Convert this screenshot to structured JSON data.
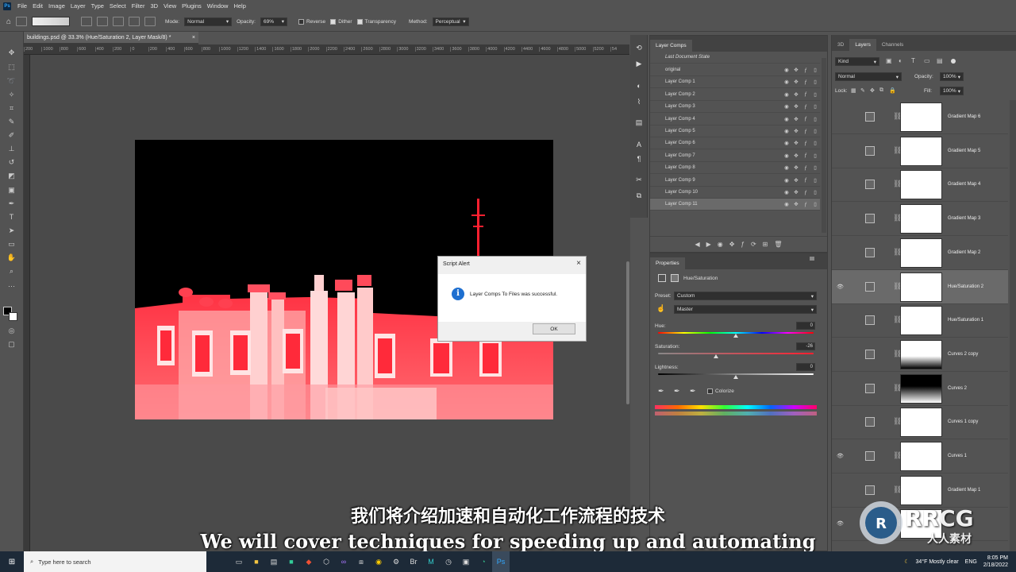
{
  "menu": [
    "File",
    "Edit",
    "Image",
    "Layer",
    "Type",
    "Select",
    "Filter",
    "3D",
    "View",
    "Plugins",
    "Window",
    "Help"
  ],
  "options": {
    "mode_label": "Mode:",
    "mode_value": "Normal",
    "opacity_label": "Opacity:",
    "opacity_value": "69%",
    "reverse_label": "Reverse",
    "dither_label": "Dither",
    "transparency_label": "Transparency",
    "method_label": "Method:",
    "method_value": "Perceptual"
  },
  "document_tab": "buildings.psd @ 33.3% (Hue/Saturation 2, Layer Mask/8) *",
  "ruler_ticks": [
    "200",
    "1000",
    "800",
    "600",
    "400",
    "200",
    "0",
    "200",
    "400",
    "600",
    "800",
    "1000",
    "1200",
    "1400",
    "1600",
    "1800",
    "2000",
    "2200",
    "2400",
    "2600",
    "2800",
    "3000",
    "3200",
    "3400",
    "3600",
    "3800",
    "4000",
    "4200",
    "4400",
    "4600",
    "4800",
    "5000",
    "5200",
    "54"
  ],
  "dialog": {
    "title": "Script Alert",
    "message": "Layer Comps To Files was successful.",
    "ok_label": "OK"
  },
  "layer_comps": {
    "tab_label": "Layer Comps",
    "last_state": "Last Document State",
    "items": [
      "original",
      "Layer Comp 1",
      "Layer Comp 2",
      "Layer Comp 3",
      "Layer Comp 4",
      "Layer Comp 5",
      "Layer Comp 6",
      "Layer Comp 7",
      "Layer Comp 8",
      "Layer Comp 9",
      "Layer Comp 10",
      "Layer Comp 11"
    ],
    "selected": "Layer Comp 11"
  },
  "properties": {
    "tab_label": "Properties",
    "adjustment_title": "Hue/Saturation",
    "preset_label": "Preset:",
    "preset_value": "Custom",
    "channel_value": "Master",
    "hue_label": "Hue:",
    "hue_value": "0",
    "saturation_label": "Saturation:",
    "saturation_value": "-26",
    "lightness_label": "Lightness:",
    "lightness_value": "0",
    "colorize_label": "Colorize"
  },
  "layers_panel": {
    "tabs": [
      "3D",
      "Layers",
      "Channels"
    ],
    "kind_label": "Kind",
    "blend_mode": "Normal",
    "opacity_label": "Opacity:",
    "opacity_value": "100%",
    "lock_label": "Lock:",
    "fill_label": "Fill:",
    "fill_value": "100%",
    "layers": [
      {
        "name": "Gradient Map 6",
        "visible": false,
        "mask": "white"
      },
      {
        "name": "Gradient Map 5",
        "visible": false,
        "mask": "white"
      },
      {
        "name": "Gradient Map 4",
        "visible": false,
        "mask": "white"
      },
      {
        "name": "Gradient Map 3",
        "visible": false,
        "mask": "white"
      },
      {
        "name": "Gradient Map 2",
        "visible": false,
        "mask": "white"
      },
      {
        "name": "Hue/Saturation 2",
        "visible": true,
        "mask": "white",
        "selected": true
      },
      {
        "name": "Hue/Saturation 1",
        "visible": false,
        "mask": "white"
      },
      {
        "name": "Curves 2 copy",
        "visible": false,
        "mask": "grad-bottom"
      },
      {
        "name": "Curves 2",
        "visible": false,
        "mask": "grad-black"
      },
      {
        "name": "Curves 1 copy",
        "visible": false,
        "mask": "white"
      },
      {
        "name": "Curves 1",
        "visible": true,
        "mask": "white"
      },
      {
        "name": "Gradient Map 1",
        "visible": false,
        "mask": "white"
      },
      {
        "name": "",
        "visible": true,
        "mask": "white"
      }
    ]
  },
  "taskbar": {
    "search_placeholder": "Type here to search",
    "weather": "34°F  Mostly clear",
    "language": "ENG",
    "time": "8:05 PM",
    "date": "2/18/2022"
  },
  "subtitles": {
    "chinese": "我们将介绍加速和自动化工作流程的技术",
    "english": "We will cover techniques for speeding up and automating"
  },
  "watermark": {
    "brand": "RRCG",
    "brand_cn": "人人素材"
  },
  "colors": {
    "accent_red": "#ff2a3a",
    "panel_bg": "#535353",
    "dialog_info": "#1e6fd0"
  }
}
